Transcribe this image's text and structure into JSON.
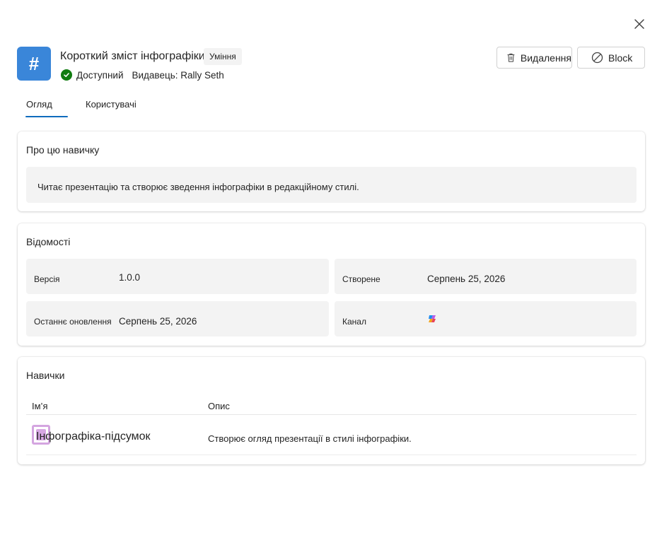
{
  "header": {
    "app_icon_glyph": "#",
    "title": "Короткий зміст інфографіки",
    "badge": "Уміння",
    "status": "Доступний",
    "publisher": "Видавець: Rally Seth",
    "delete_label": "Видалення",
    "block_label": "Block",
    "accent": "#3a86d9",
    "status_color": "#107c10"
  },
  "tabs": [
    {
      "label": "Огляд",
      "active": true
    },
    {
      "label": "Користувачі",
      "active": false
    }
  ],
  "about": {
    "title": "Про цю навичку",
    "text": "Читає презентацію та створює зведення інфографіки в редакційному стилі."
  },
  "info": {
    "title": "Відомості",
    "version_label": "Версія",
    "version_value": "1.0.0",
    "created_label": "Створене",
    "created_value": "Серпень 25, 2026",
    "updated_label": "Останнє оновлення",
    "updated_value": "Серпень 25, 2026",
    "channel_label": "Канал",
    "channel_icon": "copilot-icon"
  },
  "skills": {
    "title": "Навички",
    "col_name": "Ім’я",
    "col_desc": "Опис",
    "rows": [
      {
        "name": "Інфографіка-підсумок",
        "description": "Створює огляд презентації в стилі інфографіки."
      }
    ]
  }
}
